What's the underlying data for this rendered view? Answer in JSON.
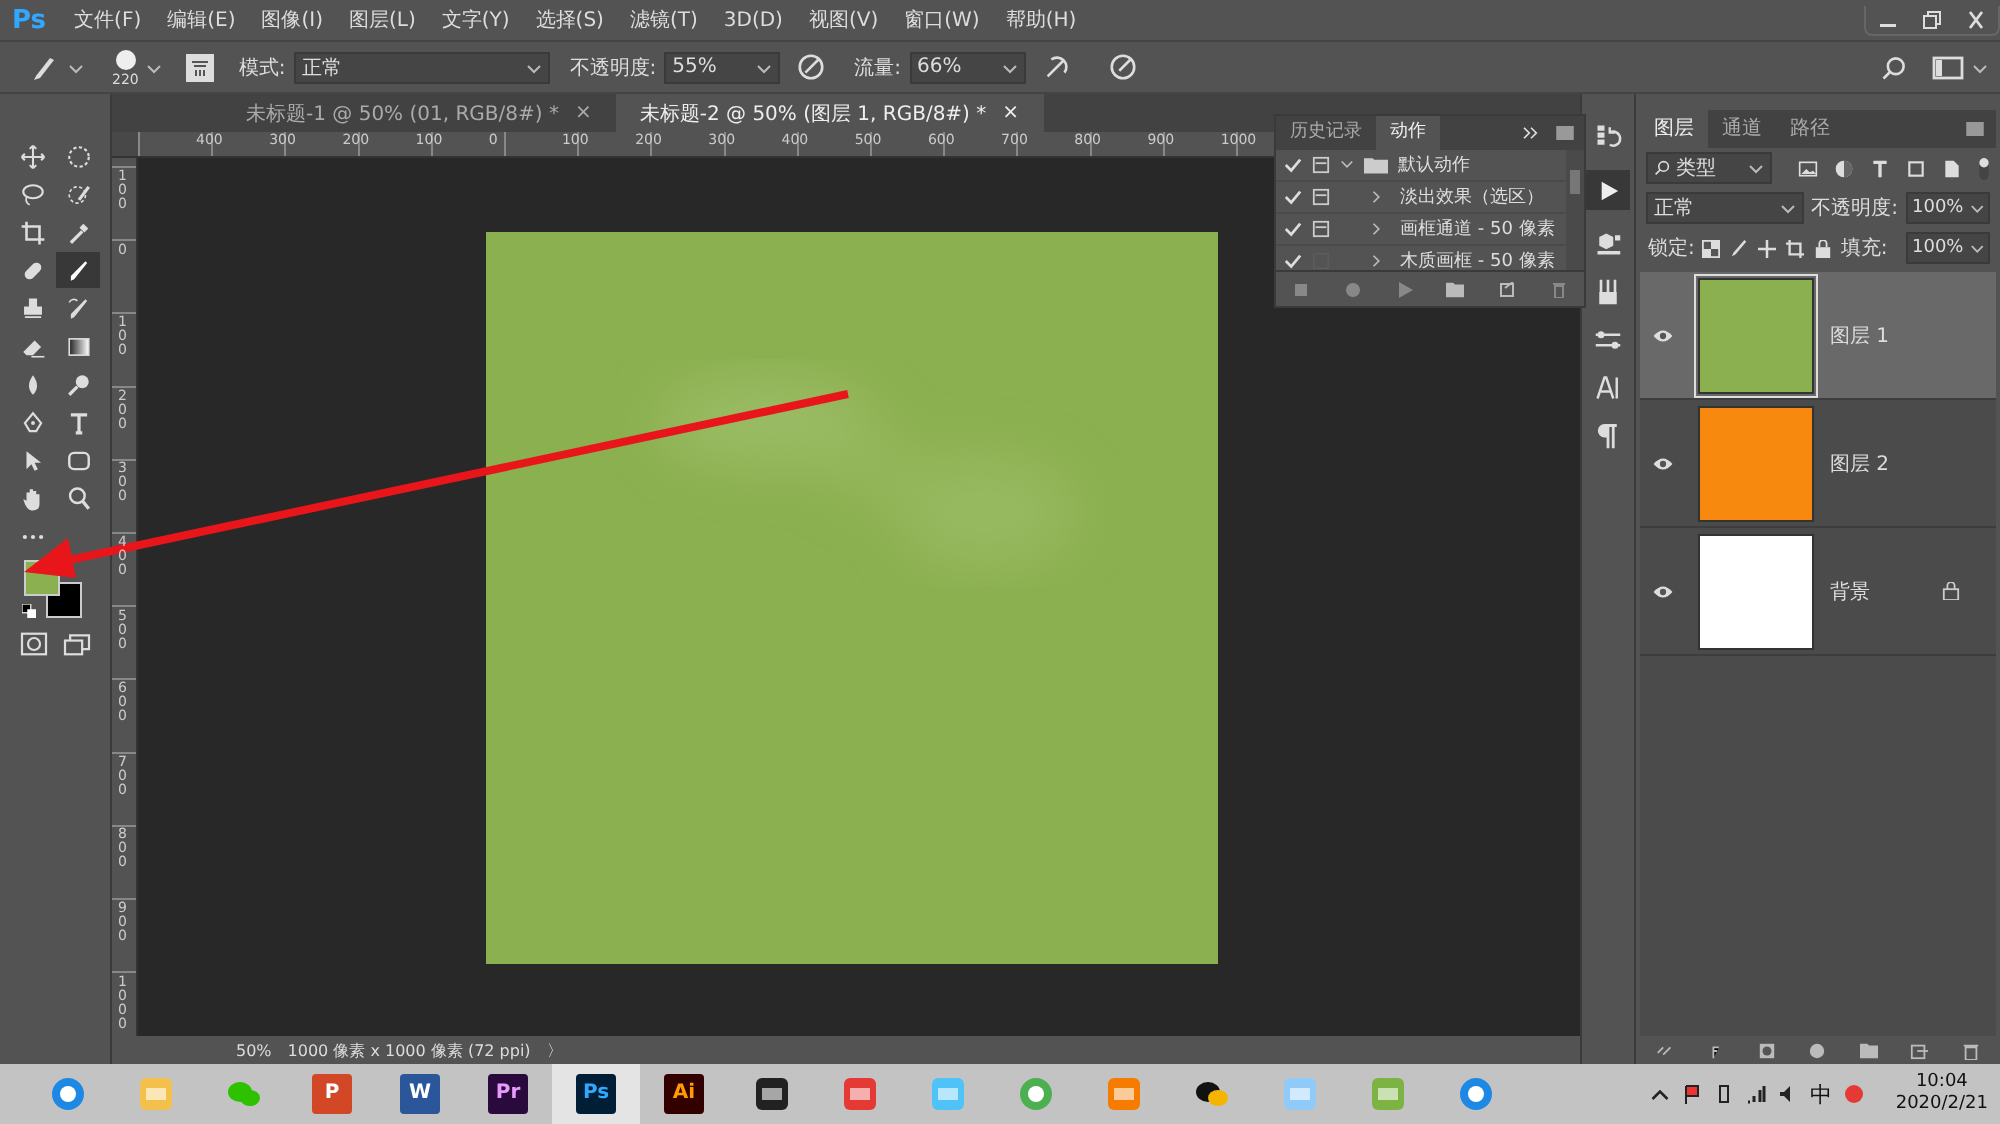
{
  "app_logo": "Ps",
  "menu": [
    "文件(F)",
    "编辑(E)",
    "图像(I)",
    "图层(L)",
    "文字(Y)",
    "选择(S)",
    "滤镜(T)",
    "3D(D)",
    "视图(V)",
    "窗口(W)",
    "帮助(H)"
  ],
  "options_bar": {
    "brush_size": "220",
    "mode_label": "模式:",
    "mode": "正常",
    "opacity_label": "不透明度:",
    "opacity": "55%",
    "flow_label": "流量:",
    "flow": "66%"
  },
  "document_tabs": [
    {
      "title": "未标题-1 @ 50% (01, RGB/8#) *",
      "close": "×",
      "selected": false
    },
    {
      "title": "未标题-2 @ 50% (图层 1, RGB/8#) *",
      "close": "×",
      "selected": true
    }
  ],
  "ruler": {
    "horizontal": [
      "400",
      "300",
      "200",
      "100",
      "0",
      "100",
      "200",
      "300",
      "400",
      "500",
      "600",
      "700",
      "800",
      "900",
      "1000"
    ],
    "vertical": [
      "100",
      "0",
      "100",
      "200",
      "300",
      "400",
      "500",
      "600",
      "700",
      "800",
      "900",
      "1000"
    ]
  },
  "tools": [
    {
      "kind": "move",
      "selected": false
    },
    {
      "kind": "marquee",
      "selected": false
    },
    {
      "kind": "lasso",
      "selected": false
    },
    {
      "kind": "quick-select",
      "selected": false
    },
    {
      "kind": "crop",
      "selected": false
    },
    {
      "kind": "eyedropper",
      "selected": false
    },
    {
      "kind": "healing",
      "selected": false
    },
    {
      "kind": "brush",
      "selected": true
    },
    {
      "kind": "stamp",
      "selected": false
    },
    {
      "kind": "history-brush",
      "selected": false
    },
    {
      "kind": "eraser",
      "selected": false
    },
    {
      "kind": "gradient",
      "selected": false
    },
    {
      "kind": "blur",
      "selected": false
    },
    {
      "kind": "dodge",
      "selected": false
    },
    {
      "kind": "pen",
      "selected": false
    },
    {
      "kind": "type",
      "selected": false
    },
    {
      "kind": "path-select",
      "selected": false
    },
    {
      "kind": "shape",
      "selected": false
    },
    {
      "kind": "hand",
      "selected": false
    },
    {
      "kind": "zoom",
      "selected": false
    },
    {
      "kind": "more",
      "selected": false
    }
  ],
  "actions_panel": {
    "tabs": [
      {
        "label": "历史记录",
        "selected": false
      },
      {
        "label": "动作",
        "selected": true
      }
    ],
    "items": [
      {
        "name": "默认动作",
        "checked": true,
        "dialog": true,
        "expanded": true,
        "children": [
          {
            "name": "淡出效果（选区）",
            "checked": true,
            "dialog": true,
            "expanded": false
          },
          {
            "name": "画框通道 - 50 像素",
            "checked": true,
            "dialog": true,
            "expanded": false
          },
          {
            "name": "木质画框 - 50 像素",
            "checked": true,
            "dialog": false,
            "expanded": false
          }
        ]
      }
    ]
  },
  "layers_panel": {
    "tabs": [
      {
        "label": "图层",
        "selected": true
      },
      {
        "label": "通道",
        "selected": false
      },
      {
        "label": "路径",
        "selected": false
      }
    ],
    "filter": "类型",
    "blend_mode": "正常",
    "opacity_label": "不透明度:",
    "opacity": "100%",
    "lock_label": "锁定:",
    "fill_label": "填充:",
    "fill": "100%",
    "layers": [
      {
        "name": "图层 1",
        "selected": true,
        "visible": true,
        "locked": false,
        "color": "#8bb04f"
      },
      {
        "name": "图层 2",
        "selected": false,
        "visible": true,
        "locked": false,
        "color": "#f7890f"
      },
      {
        "name": "背景",
        "selected": false,
        "visible": true,
        "locked": true,
        "color": "#ffffff"
      }
    ]
  },
  "status_bar": {
    "zoom": "50%",
    "info": "1000 像素 x 1000 像素 (72 ppi)",
    "more": "〉"
  },
  "taskbar": {
    "apps": [
      {
        "kind": "browser",
        "selected": false
      },
      {
        "kind": "folder",
        "selected": false
      },
      {
        "kind": "chat",
        "selected": false
      },
      {
        "kind": "slides",
        "label": "P",
        "selected": false
      },
      {
        "kind": "docs",
        "label": "W",
        "selected": false
      },
      {
        "kind": "premiere",
        "label": "Pr",
        "selected": false
      },
      {
        "kind": "photoshop",
        "label": "Ps",
        "selected": true
      },
      {
        "kind": "illustrator",
        "label": "Ai",
        "selected": false
      },
      {
        "kind": "film",
        "selected": false
      },
      {
        "kind": "umbrella",
        "selected": false
      },
      {
        "kind": "bird",
        "selected": false
      },
      {
        "kind": "chrome",
        "selected": false
      },
      {
        "kind": "flame",
        "selected": false
      },
      {
        "kind": "penguin",
        "selected": false
      },
      {
        "kind": "notepad",
        "selected": false
      },
      {
        "kind": "green-app",
        "selected": false
      },
      {
        "kind": "ie",
        "selected": false
      }
    ],
    "ime": "中",
    "time": "10:04",
    "date": "2020/2/21"
  }
}
